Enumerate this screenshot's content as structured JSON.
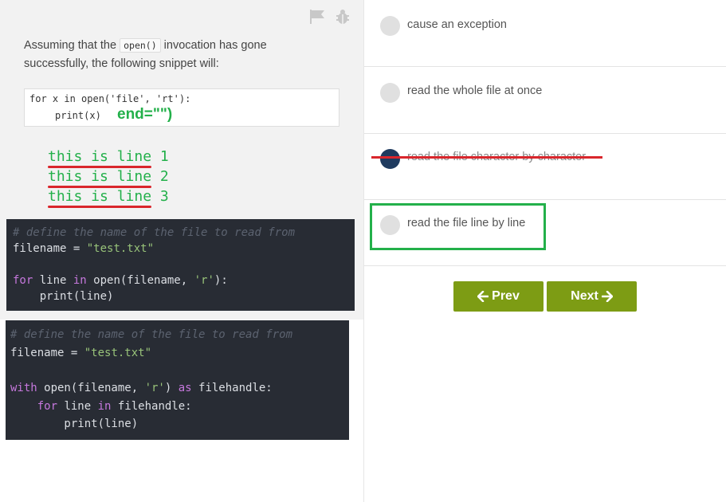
{
  "toolbar": {
    "flag_icon": "flag-icon",
    "bug_icon": "bug-icon"
  },
  "question": {
    "text_before": "Assuming that the ",
    "code_inline": "open()",
    "text_after": " invocation has gone successfully, the following snippet will:",
    "code_line1": "for x in open('file', 'rt'):",
    "code_line2": "print(x)"
  },
  "annotation": {
    "end_param": "end=\"\")",
    "output_lines": [
      "this is line 1",
      "this is line 2",
      "this is line 3"
    ]
  },
  "code_snippet_1": {
    "comment": "# define the name of the file to read from",
    "line2_var": "filename",
    "line2_op": " = ",
    "line2_str": "\"test.txt\"",
    "line3_kw1": "for",
    "line3_mid": " line ",
    "line3_kw2": "in",
    "line3_call": " open(filename, ",
    "line3_str": "'r'",
    "line3_end": "):",
    "line4": "    print(line)"
  },
  "code_snippet_2": {
    "comment": "# define the name of the file to read from",
    "line2_var": "filename",
    "line2_op": " = ",
    "line2_str": "\"test.txt\"",
    "line3_kw1": "with",
    "line3_call": " open(filename, ",
    "line3_str": "'r'",
    "line3_mid": ") ",
    "line3_kw2": "as",
    "line3_end": " filehandle:",
    "line4_indent": "    ",
    "line4_kw1": "for",
    "line4_mid": " line ",
    "line4_kw2": "in",
    "line4_end": " filehandle:",
    "line5": "        print(line)"
  },
  "options": [
    {
      "label": "cause an exception",
      "selected": false
    },
    {
      "label": "read the whole file at once",
      "selected": false
    },
    {
      "label": "read the file character by character",
      "selected": true
    },
    {
      "label": "read the file line by line",
      "selected": false
    }
  ],
  "navigation": {
    "prev_label": "Prev",
    "next_label": "Next"
  },
  "colors": {
    "button": "#7d9c14",
    "annotation_green": "#23b04a",
    "annotation_red": "#d9262c",
    "selected_radio": "#1f3b5f"
  }
}
